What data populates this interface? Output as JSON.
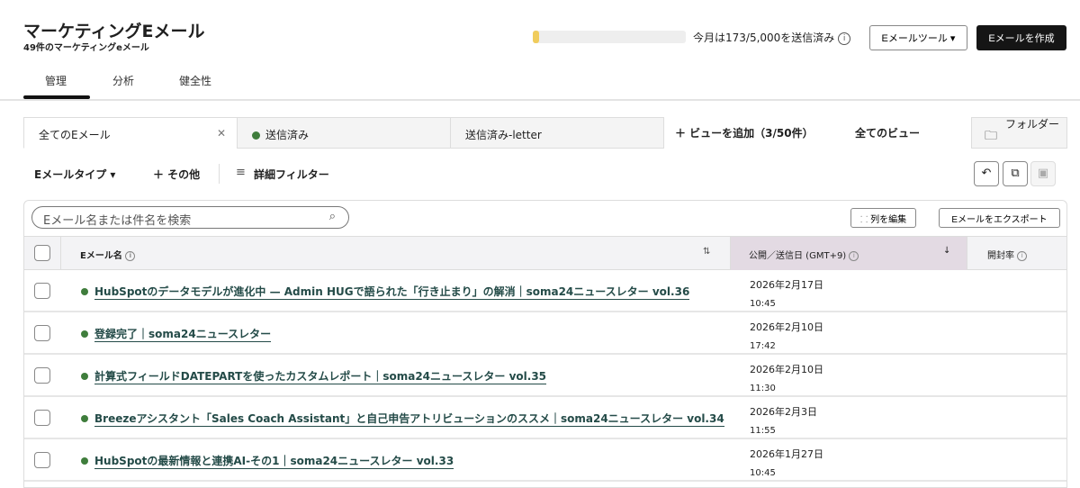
{
  "header": {
    "title": "マーケティングEメール",
    "subtitle": "49件のマーケティングeメール",
    "usage_text": "今月は173/5,000を送信済み",
    "usage_fraction": 0.0346,
    "tools_label": "Eメールツール ▾",
    "create_label": "Eメールを作成"
  },
  "tabs": [
    "管理",
    "分析",
    "健全性"
  ],
  "views": {
    "tabs": [
      "全てのEメール",
      "送信済み",
      "送信済み-letter"
    ],
    "add_view": "＋ ビューを追加（3/50件）",
    "all_views": "全てのビュー",
    "folder": "フォルダー"
  },
  "filters": {
    "email_type": "Eメールタイプ ▾",
    "more": "＋ その他",
    "advanced": "詳細フィルター"
  },
  "table": {
    "search_placeholder": "Eメール名または件名を検索",
    "edit_columns": "列を編集",
    "export": "Eメールをエクスポート",
    "columns": [
      "Eメール名",
      "公開／送信日 (GMT+9)",
      "開封率"
    ],
    "rows": [
      {
        "name": "HubSpotのデータモデルが進化中 — Admin HUGで語られた「行き止まり」の解消｜soma24ニュースレター vol.36",
        "date": "2026年2月17日",
        "time": "10:45"
      },
      {
        "name": "登録完了｜soma24ニュースレター",
        "date": "2026年2月10日",
        "time": "17:42"
      },
      {
        "name": "計算式フィールドDATEPARTを使ったカスタムレポート｜soma24ニュースレター vol.35",
        "date": "2026年2月10日",
        "time": "11:30"
      },
      {
        "name": "Breezeアシスタント「Sales Coach Assistant」と自己申告アトリビューションのススメ｜soma24ニュースレター vol.34",
        "date": "2026年2月3日",
        "time": "11:55"
      },
      {
        "name": "HubSpotの最新情報と連携AI-その1｜soma24ニュースレター vol.33",
        "date": "2026年1月27日",
        "time": "10:45"
      }
    ]
  }
}
